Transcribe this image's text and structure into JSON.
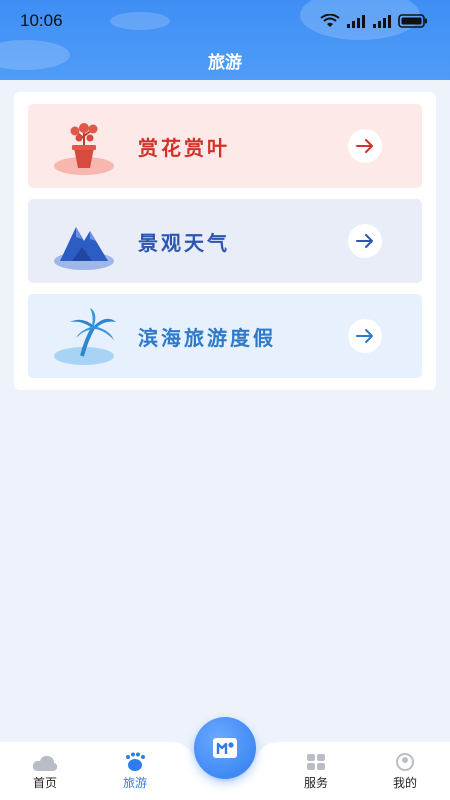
{
  "status_bar": {
    "time": "10:06"
  },
  "header": {
    "title": "旅游"
  },
  "items": [
    {
      "label": "赏花赏叶",
      "icon": "flower-pot-icon",
      "bg": "#fde9e7",
      "color": "#d0322a"
    },
    {
      "label": "景观天气",
      "icon": "mountain-icon",
      "bg": "#e8edf8",
      "color": "#2b57b0"
    },
    {
      "label": "滨海旅游度假",
      "icon": "palm-tree-icon",
      "bg": "#e6f1fd",
      "color": "#2f79c9"
    }
  ],
  "nav": {
    "home": "首页",
    "travel": "旅游",
    "service": "服务",
    "mine": "我的"
  },
  "colors": {
    "active": "#2f7cf0",
    "header": "#3e8ef5"
  }
}
